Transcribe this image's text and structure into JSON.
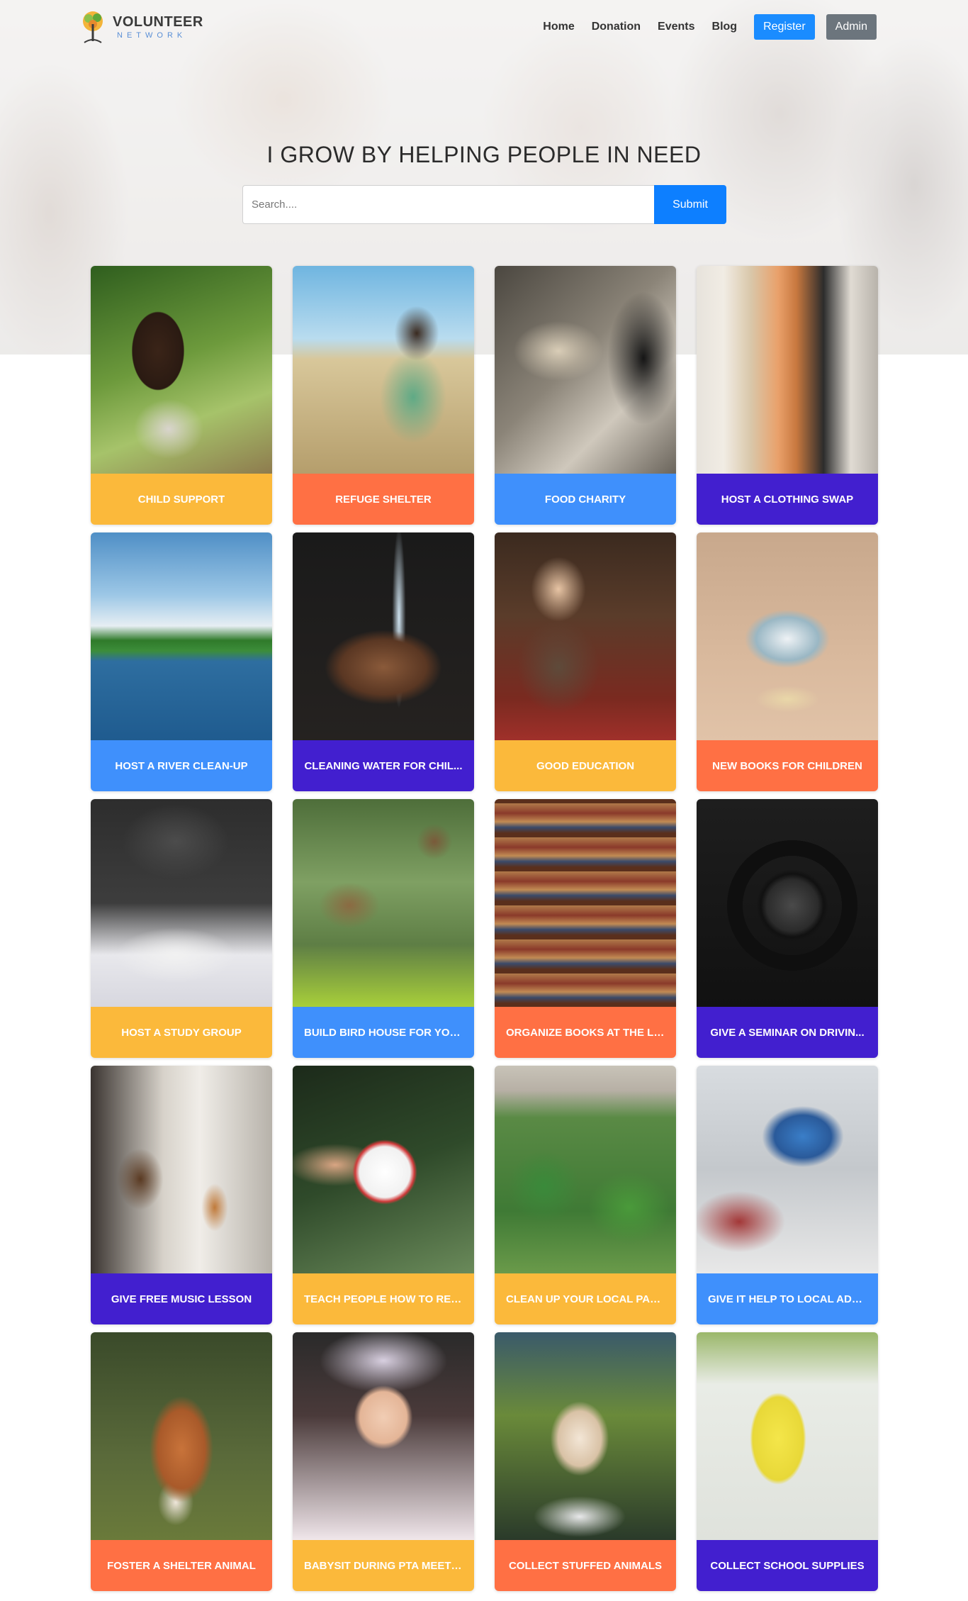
{
  "brand": {
    "title": "VOLUNTEER",
    "subtitle": "NETWORK"
  },
  "nav": {
    "links": [
      "Home",
      "Donation",
      "Events",
      "Blog"
    ],
    "register_label": "Register",
    "admin_label": "Admin"
  },
  "hero": {
    "title": "I GROW BY HELPING PEOPLE IN NEED"
  },
  "search": {
    "placeholder": "Search....",
    "value": "",
    "submit_label": "Submit"
  },
  "colors": {
    "yellow": "#fbb93b",
    "orange": "#ff7044",
    "blue": "#3f90fc",
    "purple": "#421fcf",
    "primary": "#0d7fff",
    "secondary": "#6c757d"
  },
  "cards": [
    {
      "label": "CHILD SUPPORT",
      "color": "yellow",
      "image": "girl-outdoors-photo"
    },
    {
      "label": "REFUGE SHELTER",
      "color": "orange",
      "image": "boy-in-field-photo"
    },
    {
      "label": "FOOD CHARITY",
      "color": "blue",
      "image": "food-market-photo"
    },
    {
      "label": "HOST A CLOTHING SWAP",
      "color": "purple",
      "image": "clothing-rack-photo"
    },
    {
      "label": "HOST A RIVER CLEAN-UP",
      "color": "blue",
      "image": "river-photo"
    },
    {
      "label": "CLEANING WATER FOR CHIL...",
      "color": "purple",
      "image": "water-hands-photo"
    },
    {
      "label": "GOOD EDUCATION",
      "color": "yellow",
      "image": "boy-reading-library-photo"
    },
    {
      "label": "NEW BOOKS FOR CHILDREN",
      "color": "orange",
      "image": "open-book-photo"
    },
    {
      "label": "HOST A STUDY GROUP",
      "color": "yellow",
      "image": "study-notes-photo"
    },
    {
      "label": "BUILD BIRD HOUSE FOR YOU...",
      "color": "blue",
      "image": "bird-house-photo"
    },
    {
      "label": "ORGANIZE BOOKS AT THE LI...",
      "color": "orange",
      "image": "bookshelf-photo"
    },
    {
      "label": "GIVE A SEMINAR ON DRIVIN...",
      "color": "purple",
      "image": "steering-wheel-photo"
    },
    {
      "label": "GIVE FREE MUSIC LESSON",
      "color": "purple",
      "image": "guitar-room-photo"
    },
    {
      "label": "TEACH PEOPLE HOW TO REGI...",
      "color": "yellow",
      "image": "i-voted-sticker-photo"
    },
    {
      "label": "CLEAN UP YOUR LOCAL PARK",
      "color": "yellow",
      "image": "city-park-photo"
    },
    {
      "label": "GIVE IT HELP TO LOCAL ADUL...",
      "color": "blue",
      "image": "laptop-photo"
    },
    {
      "label": "FOSTER A SHELTER ANIMAL",
      "color": "orange",
      "image": "fox-photo"
    },
    {
      "label": "BABYSIT DURING PTA MEETI...",
      "color": "yellow",
      "image": "baby-photo"
    },
    {
      "label": "COLLECT STUFFED ANIMALS",
      "color": "orange",
      "image": "fluffy-dog-photo"
    },
    {
      "label": "COLLECT SCHOOL SUPPLIES",
      "color": "purple",
      "image": "love-to-learn-sign-photo"
    }
  ]
}
